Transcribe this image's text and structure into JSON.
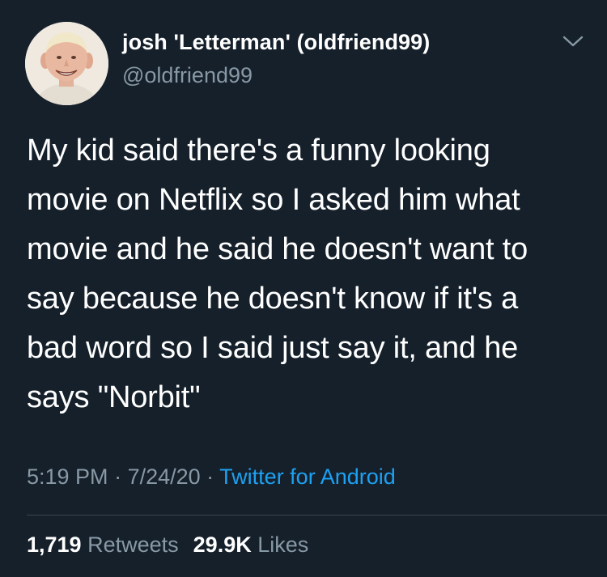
{
  "user": {
    "display_name": "josh 'Letterman' (oldfriend99)",
    "handle": "@oldfriend99"
  },
  "tweet": {
    "text": "My kid said there's a funny looking\nmovie on Netflix so I asked him what\nmovie and he said he doesn't want to\nsay because he doesn't know if it's a\nbad word so I said just say it, and he\nsays \"Norbit\""
  },
  "meta": {
    "time": "5:19 PM",
    "separator": " · ",
    "date": "7/24/20",
    "source": "Twitter for Android"
  },
  "stats": {
    "retweets_count": "1,719",
    "retweets_label": "Retweets",
    "likes_count": "29.9K",
    "likes_label": "Likes"
  },
  "icons": {
    "menu": "chevron-down-icon",
    "avatar": "avatar"
  },
  "colors": {
    "background": "#15202b",
    "text_primary": "#ffffff",
    "text_secondary": "#8899a6",
    "link": "#1da1f2",
    "divider": "#38444d"
  }
}
